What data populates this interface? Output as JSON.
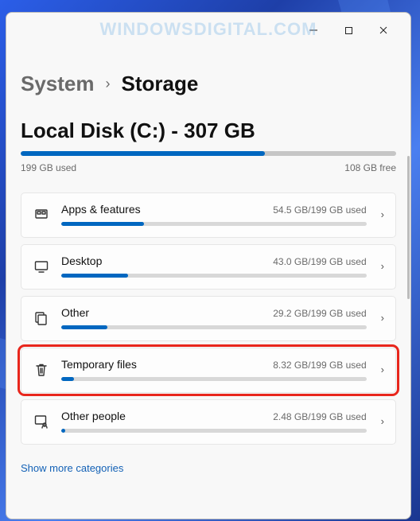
{
  "watermark": "WINDOWSDIGITAL.COM",
  "breadcrumb": {
    "parent": "System",
    "current": "Storage"
  },
  "disk": {
    "title": "Local Disk (C:) - 307 GB",
    "used_label": "199 GB used",
    "free_label": "108 GB free",
    "fill_pct": 65
  },
  "categories": [
    {
      "icon": "apps",
      "name": "Apps & features",
      "size": "54.5 GB/199 GB used",
      "fill_pct": 27,
      "highlight": false
    },
    {
      "icon": "desktop",
      "name": "Desktop",
      "size": "43.0 GB/199 GB used",
      "fill_pct": 22,
      "highlight": false
    },
    {
      "icon": "other",
      "name": "Other",
      "size": "29.2 GB/199 GB used",
      "fill_pct": 15,
      "highlight": false
    },
    {
      "icon": "trash",
      "name": "Temporary files",
      "size": "8.32 GB/199 GB used",
      "fill_pct": 4.2,
      "highlight": true
    },
    {
      "icon": "people",
      "name": "Other people",
      "size": "2.48 GB/199 GB used",
      "fill_pct": 1.3,
      "highlight": false
    }
  ],
  "showmore": "Show more categories",
  "colors": {
    "accent": "#0067c0",
    "highlight_border": "#e8261c"
  }
}
